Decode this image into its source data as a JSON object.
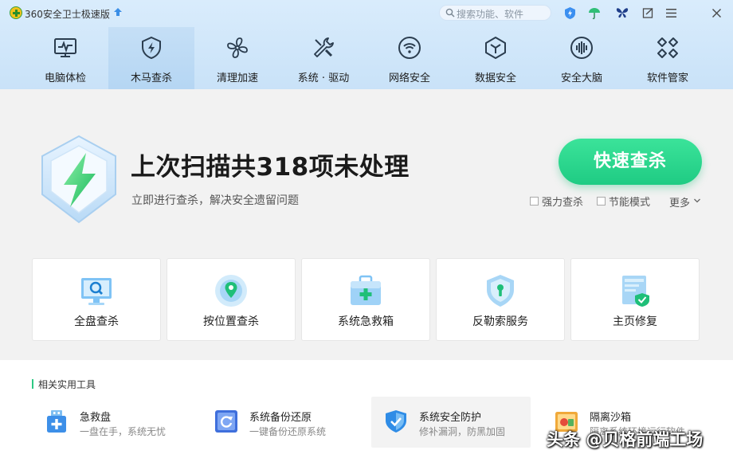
{
  "app": {
    "title": "360安全卫士极速版"
  },
  "search": {
    "placeholder": "搜索功能、软件"
  },
  "titlebar_icons": [
    "security-badge-icon",
    "umbrella-icon",
    "butterfly-icon",
    "feedback-icon",
    "menu-icon",
    "close-icon"
  ],
  "nav": {
    "items": [
      {
        "label": "电脑体检",
        "icon": "monitor-pulse-icon",
        "active": false
      },
      {
        "label": "木马查杀",
        "icon": "shield-bolt-icon",
        "active": true
      },
      {
        "label": "清理加速",
        "icon": "fan-icon",
        "active": false
      },
      {
        "label": "系统 · 驱动",
        "icon": "tools-icon",
        "active": false
      },
      {
        "label": "网络安全",
        "icon": "wifi-icon",
        "active": false
      },
      {
        "label": "数据安全",
        "icon": "cube-icon",
        "active": false
      },
      {
        "label": "安全大脑",
        "icon": "brain-icon",
        "active": false
      },
      {
        "label": "软件管家",
        "icon": "apps-icon",
        "active": false
      }
    ]
  },
  "hero": {
    "title": "上次扫描共318项未处理",
    "subtitle": "立即进行查杀，解决安全遗留问题",
    "scan_button": "快速查杀",
    "options": [
      {
        "label": "强力查杀",
        "checked": false
      },
      {
        "label": "节能模式",
        "checked": false
      }
    ],
    "more": "更多"
  },
  "cards": [
    {
      "label": "全盘查杀",
      "icon": "full-scan-icon"
    },
    {
      "label": "按位置查杀",
      "icon": "location-scan-icon"
    },
    {
      "label": "系统急救箱",
      "icon": "first-aid-kit-icon"
    },
    {
      "label": "反勒索服务",
      "icon": "ransomware-shield-icon"
    },
    {
      "label": "主页修复",
      "icon": "homepage-repair-icon"
    }
  ],
  "tools": {
    "heading": "相关实用工具",
    "items": [
      {
        "name": "急救盘",
        "desc": "一盘在手，系统无忧",
        "icon": "rescue-disk-icon"
      },
      {
        "name": "系统备份还原",
        "desc": "一键备份还原系统",
        "icon": "backup-restore-icon"
      },
      {
        "name": "系统安全防护",
        "desc": "修补漏洞，防黑加固",
        "icon": "system-protection-icon"
      },
      {
        "name": "隔离沙箱",
        "desc": "隔离系统环境运行软件",
        "icon": "sandbox-icon"
      }
    ]
  },
  "watermark": "头条 @贝格前端工场",
  "colors": {
    "accent_green": "#22cf86",
    "nav_bg": "#d4e8fb",
    "icon_dark": "#2b3d4f"
  }
}
